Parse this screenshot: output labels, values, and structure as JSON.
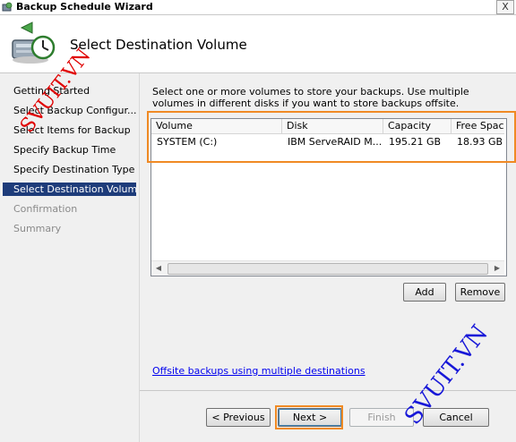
{
  "window": {
    "title": "Backup Schedule Wizard",
    "close_glyph": "X"
  },
  "header": {
    "title": "Select Destination Volume",
    "icon": "backup-schedule-icon"
  },
  "nav": {
    "items": [
      {
        "label": "Getting Started",
        "state": "normal"
      },
      {
        "label": "Select Backup Configur...",
        "state": "normal"
      },
      {
        "label": "Select Items for Backup",
        "state": "normal"
      },
      {
        "label": "Specify Backup Time",
        "state": "normal"
      },
      {
        "label": "Specify Destination Type",
        "state": "normal"
      },
      {
        "label": "Select Destination Volume",
        "state": "selected"
      },
      {
        "label": "Confirmation",
        "state": "disabled"
      },
      {
        "label": "Summary",
        "state": "disabled"
      }
    ]
  },
  "main": {
    "instructions": "Select one or more volumes to store your backups. Use multiple volumes in different disks if you want to store backups offsite.",
    "table": {
      "columns": [
        "Volume",
        "Disk",
        "Capacity",
        "Free Space"
      ],
      "rows": [
        [
          "SYSTEM (C:)",
          "IBM ServeRAID M...",
          "195.21 GB",
          "18.93 GB"
        ]
      ]
    },
    "add_label": "Add",
    "remove_label": "Remove",
    "offsite_link": "Offsite backups using multiple destinations"
  },
  "footer": {
    "previous_label": "< Previous",
    "next_label": "Next >",
    "finish_label": "Finish",
    "cancel_label": "Cancel"
  },
  "watermarks": {
    "top_left": "SVUIT.VN",
    "bottom_right": "SVUIT.VN"
  },
  "colors": {
    "highlight": "#f08a24",
    "nav_selected": "#1e3c7a",
    "link": "#0000ee",
    "watermark_red": "#e00000",
    "watermark_blue": "#1818d8"
  }
}
